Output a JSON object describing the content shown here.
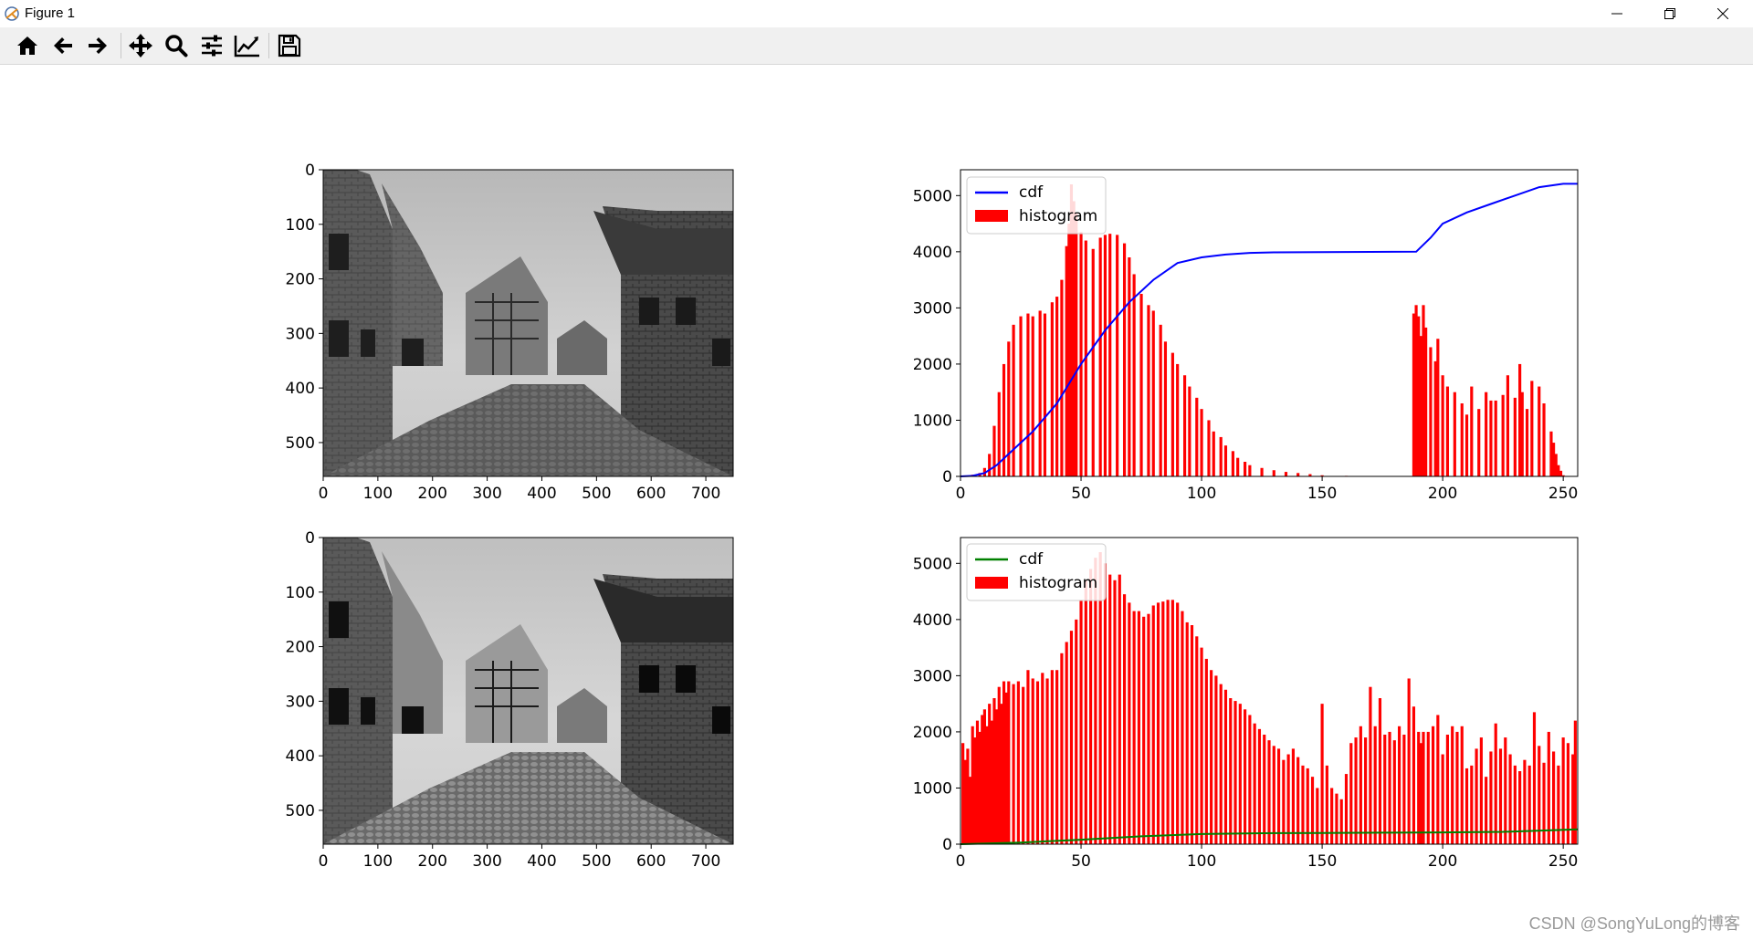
{
  "window": {
    "title": "Figure 1"
  },
  "toolbar": {
    "buttons": [
      "home-icon",
      "back-arrow-icon",
      "forward-arrow-icon",
      "pan-icon",
      "zoom-icon",
      "subplots-config-icon",
      "edit-axes-icon",
      "save-icon"
    ]
  },
  "watermark": "CSDN @SongYuLong的博客",
  "chart_data": [
    {
      "type": "image",
      "panel": "original image (grayscale)",
      "x_ticks": [
        "0",
        "100",
        "200",
        "300",
        "400",
        "500",
        "600",
        "700"
      ],
      "y_ticks": [
        "0",
        "100",
        "200",
        "300",
        "400",
        "500"
      ],
      "xlim": [
        0,
        750
      ],
      "ylim": [
        562,
        0
      ]
    },
    {
      "type": "bar",
      "panel": "original histogram + cdf",
      "x_ticks": [
        "0",
        "50",
        "100",
        "150",
        "200",
        "250"
      ],
      "y_ticks": [
        "0",
        "1000",
        "2000",
        "3000",
        "4000",
        "5000"
      ],
      "xlim": [
        0,
        256
      ],
      "ylim": [
        0,
        5460
      ],
      "legend": [
        "cdf",
        "histogram"
      ],
      "legend_loc": "upper left",
      "colors": {
        "histogram": "#ff0000",
        "cdf": "#0000ff"
      },
      "series": [
        {
          "name": "histogram",
          "kind": "bars",
          "x": [
            5,
            8,
            10,
            12,
            14,
            16,
            18,
            20,
            22,
            25,
            28,
            30,
            33,
            35,
            38,
            40,
            42,
            44,
            45,
            46,
            47,
            48,
            50,
            52,
            55,
            58,
            60,
            62,
            65,
            68,
            70,
            72,
            75,
            78,
            80,
            83,
            85,
            88,
            90,
            93,
            95,
            98,
            100,
            103,
            105,
            108,
            110,
            113,
            115,
            118,
            120,
            125,
            130,
            135,
            140,
            145,
            150,
            160,
            170,
            180,
            187,
            188,
            189,
            190,
            191,
            192,
            193,
            195,
            197,
            198,
            200,
            202,
            205,
            208,
            210,
            212,
            215,
            218,
            220,
            222,
            225,
            227,
            230,
            232,
            233,
            235,
            237,
            240,
            242,
            245,
            246,
            247,
            248,
            249,
            250
          ],
          "values": [
            30,
            60,
            150,
            400,
            900,
            1500,
            2000,
            2400,
            2700,
            2850,
            2900,
            2850,
            2950,
            2900,
            3100,
            3200,
            3500,
            4100,
            4500,
            5200,
            4900,
            4700,
            4350,
            4200,
            4050,
            4250,
            4300,
            4320,
            4300,
            4150,
            3900,
            3600,
            3250,
            3050,
            2950,
            2700,
            2400,
            2200,
            2000,
            1800,
            1600,
            1400,
            1200,
            1000,
            800,
            700,
            550,
            450,
            330,
            260,
            200,
            150,
            110,
            80,
            60,
            40,
            20,
            10,
            5,
            5,
            0,
            2900,
            3050,
            2850,
            2500,
            3050,
            2650,
            2300,
            2050,
            2450,
            1800,
            1600,
            1500,
            1300,
            1100,
            1600,
            1200,
            1500,
            1350,
            1350,
            1450,
            1800,
            1400,
            2000,
            1500,
            1200,
            1700,
            1600,
            1300,
            800,
            600,
            400,
            200,
            100,
            20
          ]
        },
        {
          "name": "cdf",
          "kind": "line",
          "x": [
            0,
            5,
            10,
            15,
            20,
            30,
            40,
            45,
            50,
            60,
            70,
            80,
            90,
            100,
            110,
            120,
            130,
            150,
            170,
            189,
            195,
            200,
            210,
            220,
            230,
            240,
            250,
            256
          ],
          "values": [
            0,
            10,
            60,
            200,
            400,
            800,
            1300,
            1650,
            2000,
            2600,
            3100,
            3500,
            3800,
            3900,
            3950,
            3980,
            3990,
            3995,
            3998,
            4000,
            4250,
            4500,
            4700,
            4850,
            5000,
            5150,
            5210,
            5210
          ]
        }
      ]
    },
    {
      "type": "image",
      "panel": "equalized image (grayscale)",
      "x_ticks": [
        "0",
        "100",
        "200",
        "300",
        "400",
        "500",
        "600",
        "700"
      ],
      "y_ticks": [
        "0",
        "100",
        "200",
        "300",
        "400",
        "500"
      ],
      "xlim": [
        0,
        750
      ],
      "ylim": [
        562,
        0
      ]
    },
    {
      "type": "bar",
      "panel": "equalized histogram + cdf",
      "x_ticks": [
        "0",
        "50",
        "100",
        "150",
        "200",
        "250"
      ],
      "y_ticks": [
        "0",
        "1000",
        "2000",
        "3000",
        "4000",
        "5000"
      ],
      "xlim": [
        0,
        256
      ],
      "ylim": [
        0,
        5460
      ],
      "legend": [
        "cdf",
        "histogram"
      ],
      "legend_loc": "upper left",
      "colors": {
        "histogram": "#ff0000",
        "cdf": "#008000"
      },
      "series": [
        {
          "name": "histogram",
          "kind": "bars",
          "x": [
            1,
            2,
            3,
            4,
            5,
            6,
            7,
            8,
            9,
            10,
            11,
            12,
            13,
            14,
            15,
            16,
            17,
            18,
            19,
            20,
            22,
            24,
            26,
            28,
            30,
            32,
            34,
            36,
            38,
            40,
            42,
            44,
            46,
            48,
            50,
            52,
            54,
            56,
            58,
            60,
            62,
            64,
            66,
            68,
            70,
            72,
            74,
            76,
            78,
            80,
            82,
            84,
            86,
            88,
            90,
            92,
            94,
            96,
            98,
            100,
            102,
            104,
            106,
            108,
            110,
            112,
            114,
            116,
            118,
            120,
            122,
            124,
            126,
            128,
            130,
            132,
            134,
            136,
            138,
            140,
            142,
            144,
            146,
            148,
            150,
            152,
            154,
            156,
            158,
            160,
            162,
            164,
            166,
            168,
            170,
            172,
            174,
            176,
            178,
            180,
            182,
            184,
            186,
            188,
            190,
            191,
            192,
            194,
            196,
            198,
            200,
            202,
            204,
            206,
            208,
            210,
            212,
            214,
            216,
            218,
            220,
            222,
            224,
            226,
            228,
            230,
            232,
            234,
            236,
            238,
            240,
            242,
            244,
            246,
            248,
            250,
            252,
            254,
            255
          ],
          "values": [
            1800,
            1500,
            1700,
            1200,
            2100,
            1900,
            2200,
            2000,
            2300,
            2400,
            2100,
            2500,
            2200,
            2600,
            2400,
            2800,
            2500,
            2900,
            2700,
            2900,
            2850,
            2900,
            2800,
            3100,
            2950,
            2900,
            3050,
            2950,
            3100,
            3100,
            3400,
            3600,
            3800,
            4000,
            4350,
            4700,
            4900,
            5100,
            5200,
            5000,
            4800,
            4700,
            4800,
            4450,
            4300,
            4150,
            4150,
            4050,
            4100,
            4250,
            4300,
            4320,
            4350,
            4350,
            4300,
            4150,
            3950,
            3900,
            3700,
            3500,
            3300,
            3100,
            3000,
            2850,
            2750,
            2600,
            2550,
            2500,
            2400,
            2300,
            2150,
            2050,
            1950,
            1850,
            1750,
            1700,
            1500,
            1600,
            1700,
            1550,
            1400,
            1350,
            1200,
            1000,
            2500,
            1400,
            1000,
            900,
            800,
            1250,
            1800,
            1900,
            2100,
            1900,
            2800,
            2100,
            2600,
            1950,
            2000,
            1850,
            2100,
            1950,
            2950,
            2450,
            2000,
            1800,
            2000,
            2000,
            2100,
            2300,
            1600,
            1950,
            2100,
            2000,
            2100,
            1350,
            1400,
            1700,
            1900,
            1200,
            1650,
            2150,
            1700,
            1900,
            1600,
            1400,
            1300,
            1500,
            1400,
            2350,
            1750,
            1450,
            2000,
            1650,
            1400,
            1900,
            1800,
            1600,
            2200
          ]
        },
        {
          "name": "cdf",
          "kind": "line",
          "x": [
            0,
            25,
            50,
            75,
            100,
            125,
            150,
            175,
            200,
            225,
            256
          ],
          "values": [
            0,
            30,
            80,
            140,
            180,
            195,
            200,
            205,
            210,
            220,
            265
          ]
        }
      ]
    }
  ]
}
